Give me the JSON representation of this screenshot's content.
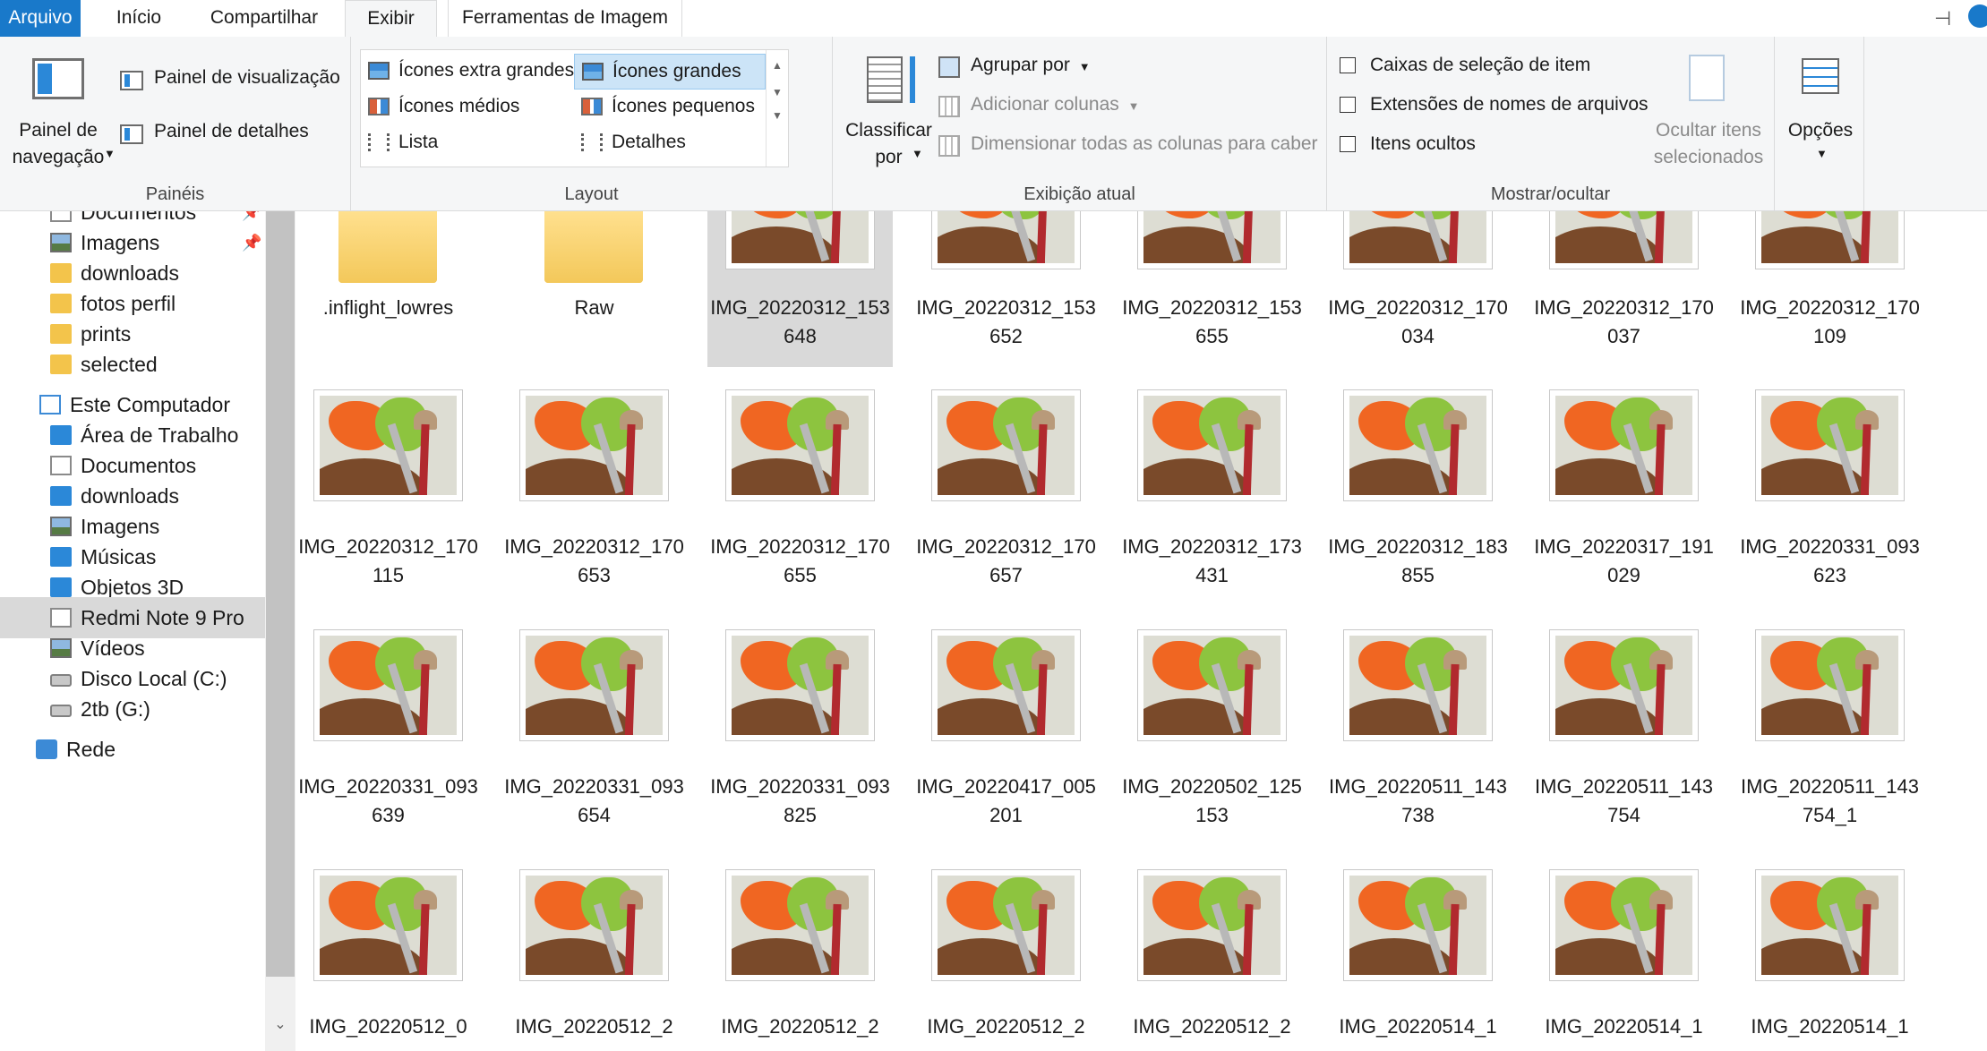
{
  "ribbon": {
    "tabs": {
      "file": "Arquivo",
      "home": "Início",
      "share": "Compartilhar",
      "view": "Exibir",
      "image_tools": "Ferramentas de Imagem"
    },
    "panes": {
      "nav_pane": "Painel de navegação",
      "preview_pane": "Painel de visualização",
      "details_pane": "Painel de detalhes",
      "group_label": "Painéis"
    },
    "layout": {
      "extra_large": "Ícones extra grandes",
      "large": "Ícones grandes",
      "medium": "Ícones médios",
      "small": "Ícones pequenos",
      "list": "Lista",
      "details": "Detalhes",
      "group_label": "Layout"
    },
    "current_view": {
      "sort_by": "Classificar por",
      "group_by": "Agrupar por",
      "add_columns": "Adicionar colunas",
      "size_all_columns": "Dimensionar todas as colunas para caber",
      "group_label": "Exibição atual"
    },
    "show_hide": {
      "item_checkboxes": "Caixas de seleção de item",
      "file_extensions": "Extensões de nomes de arquivos",
      "hidden_items": "Itens ocultos",
      "hide_selected": "Ocultar itens selecionados",
      "group_label": "Mostrar/ocultar"
    },
    "options": "Opções",
    "accent_color": "#1979ca"
  },
  "nav": {
    "items": [
      {
        "label": "Documentos",
        "icon": "document-icon",
        "pinned": true
      },
      {
        "label": "Imagens",
        "icon": "pictures-icon",
        "pinned": true
      },
      {
        "label": "downloads",
        "icon": "folder-icon"
      },
      {
        "label": "fotos perfil",
        "icon": "folder-icon"
      },
      {
        "label": "prints",
        "icon": "folder-icon"
      },
      {
        "label": "selected",
        "icon": "folder-icon"
      },
      {
        "label": "Este Computador",
        "icon": "computer-icon"
      },
      {
        "label": "Área de Trabalho",
        "icon": "desktop-icon"
      },
      {
        "label": "Documentos",
        "icon": "document-icon"
      },
      {
        "label": "downloads",
        "icon": "download-icon"
      },
      {
        "label": "Imagens",
        "icon": "pictures-icon"
      },
      {
        "label": "Músicas",
        "icon": "music-icon"
      },
      {
        "label": "Objetos 3D",
        "icon": "3d-objects-icon"
      },
      {
        "label": "Redmi Note 9 Pro",
        "icon": "phone-icon",
        "selected": true
      },
      {
        "label": "Vídeos",
        "icon": "videos-icon"
      },
      {
        "label": "Disco Local (C:)",
        "icon": "drive-icon"
      },
      {
        "label": "2tb (G:)",
        "icon": "drive-icon"
      },
      {
        "label": "Rede",
        "icon": "network-icon"
      }
    ]
  },
  "files": {
    "row1": [
      {
        "name": ".inflight_lowres",
        "type": "folder"
      },
      {
        "name": "Raw",
        "type": "folder"
      },
      {
        "name": "IMG_20220312_153648",
        "type": "image",
        "selected": true
      },
      {
        "name": "IMG_20220312_153652",
        "type": "image"
      },
      {
        "name": "IMG_20220312_153655",
        "type": "image"
      },
      {
        "name": "IMG_20220312_170034",
        "type": "image"
      },
      {
        "name": "IMG_20220312_170037",
        "type": "image"
      },
      {
        "name": "IMG_20220312_170109",
        "type": "image"
      }
    ],
    "row2": [
      {
        "name": "IMG_20220312_170115"
      },
      {
        "name": "IMG_20220312_170653"
      },
      {
        "name": "IMG_20220312_170655"
      },
      {
        "name": "IMG_20220312_170657"
      },
      {
        "name": "IMG_20220312_173431"
      },
      {
        "name": "IMG_20220312_183855"
      },
      {
        "name": "IMG_20220317_191029"
      },
      {
        "name": "IMG_20220331_093623"
      }
    ],
    "row3": [
      {
        "name": "IMG_20220331_093639"
      },
      {
        "name": "IMG_20220331_093654"
      },
      {
        "name": "IMG_20220331_093825"
      },
      {
        "name": "IMG_20220417_005201"
      },
      {
        "name": "IMG_20220502_125153"
      },
      {
        "name": "IMG_20220511_143738"
      },
      {
        "name": "IMG_20220511_143754"
      },
      {
        "name": "IMG_20220511_143754_1"
      }
    ],
    "row4": [
      {
        "name": "IMG_20220512_0"
      },
      {
        "name": "IMG_20220512_2"
      },
      {
        "name": "IMG_20220512_2"
      },
      {
        "name": "IMG_20220512_2"
      },
      {
        "name": "IMG_20220512_2"
      },
      {
        "name": "IMG_20220514_1"
      },
      {
        "name": "IMG_20220514_1"
      },
      {
        "name": "IMG_20220514_1"
      }
    ]
  }
}
